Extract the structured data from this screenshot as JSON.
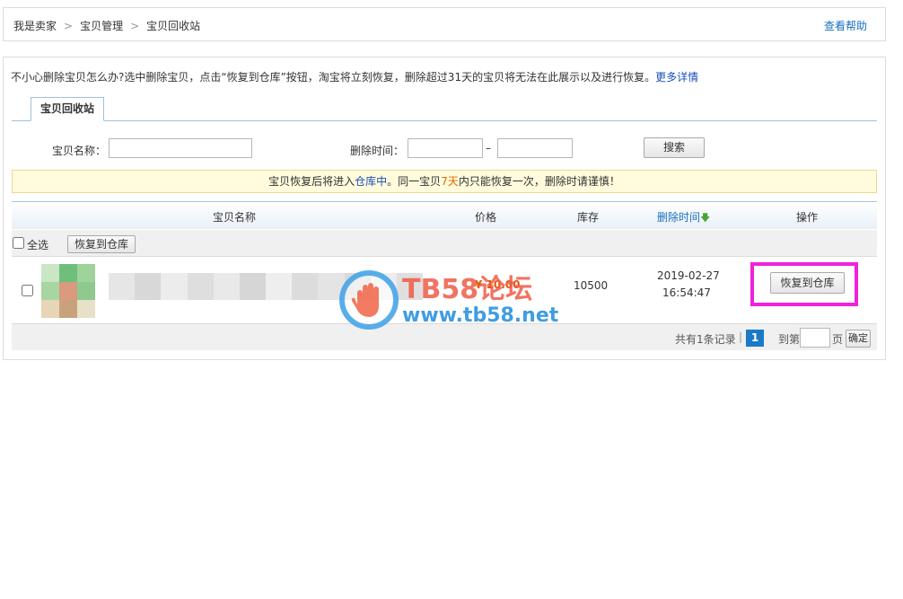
{
  "breadcrumb": [
    "我是卖家",
    "宝贝管理",
    "宝贝回收站"
  ],
  "breadcrumb_sep": ">",
  "help_link": "查看帮助",
  "notice": {
    "text": "不小心删除宝贝怎么办?选中删除宝贝，点击“恢复到仓库”按钮，淘宝将立刻恢复，删除超过31天的宝贝将无法在此展示以及进行恢复。",
    "link": "更多详情"
  },
  "tab_label": "宝贝回收站",
  "search": {
    "name_label": "宝贝名称：",
    "name_value": "",
    "time_label": "删除时间：",
    "time_from": "",
    "time_to": "",
    "dash": "–",
    "button": "搜索"
  },
  "tip": {
    "part1": "宝贝恢复后将进入",
    "link": "仓库中",
    "part2": "。同一宝贝",
    "days": "7天",
    "part3": "内只能恢复一次，删除时请谨慎！"
  },
  "columns": {
    "name": "宝贝名称",
    "price": "价格",
    "stock": "库存",
    "deleted_time": "删除时间",
    "action": "操作"
  },
  "sort_arrow": "🡇",
  "bulk": {
    "select_all": "全选",
    "restore_button": "恢复到仓库"
  },
  "items": [
    {
      "price": "¥ 10.00",
      "stock": "10500",
      "deleted_date": "2019-02-27",
      "deleted_time": "16:54:47",
      "action_button": "恢复到仓库"
    }
  ],
  "pager": {
    "total_text": "共有1条记录",
    "divider": "|",
    "current_page": "1",
    "goto_prefix": "到第",
    "goto_suffix": "页",
    "confirm": "确定"
  },
  "watermark": {
    "title": "TB58论坛",
    "url": "www.tb58.net"
  },
  "colors": {
    "link_blue": "#1a4fb8",
    "page_blue": "#1a7ac7",
    "highlight_magenta": "#ee22dd",
    "tip_orange": "#e06a00"
  }
}
